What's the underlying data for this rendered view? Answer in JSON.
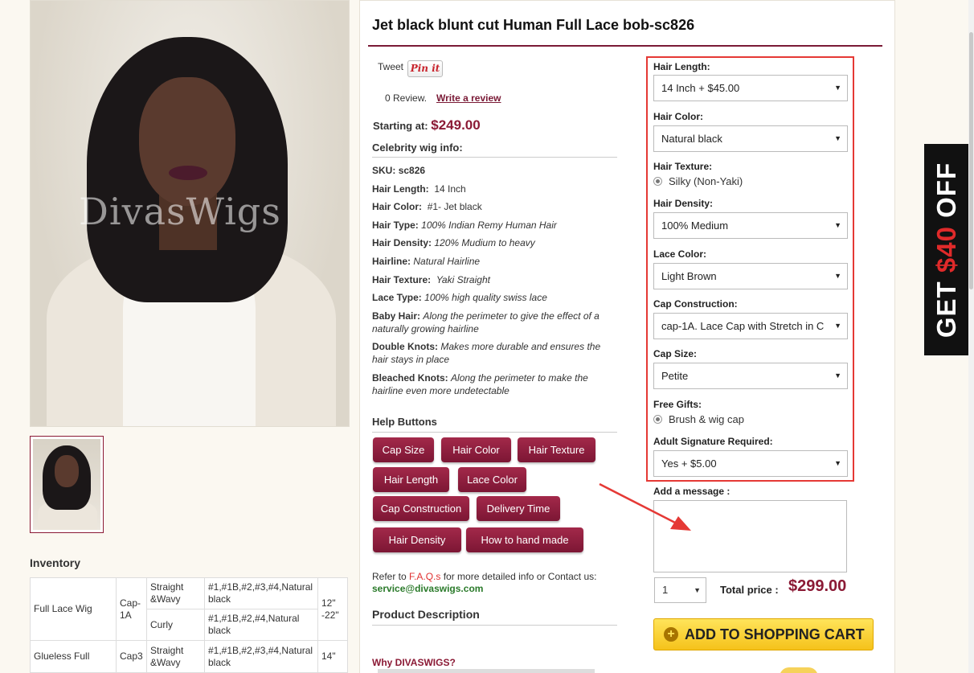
{
  "product": {
    "title": "Jet black blunt cut Human Full Lace bob-sc826",
    "watermark": "DivasWigs",
    "tweet_label": "Tweet",
    "pin_label": "Pin it",
    "review_count": "0 Review.",
    "write_review": "Write a review",
    "starting_label": "Starting at:",
    "starting_price": "$249.00"
  },
  "info": {
    "title": "Celebrity wig info:",
    "sku_k": "SKU:",
    "sku_v": "sc826",
    "length_k": "Hair Length:",
    "length_v": "14 Inch",
    "color_k": "Hair Color:",
    "color_v": "#1- Jet black",
    "type_k": "Hair Type:",
    "type_v": "100% Indian Remy Human Hair",
    "density_k": "Hair Density:",
    "density_v": "120% Mudium to heavy",
    "hairline_k": "Hairline:",
    "hairline_v": "Natural Hairline",
    "texture_k": "Hair Texture:",
    "texture_v": "Yaki Straight",
    "lace_k": "Lace Type:",
    "lace_v": "100% high quality swiss lace",
    "baby_k": "Baby Hair:",
    "baby_v": "Along the perimeter to give the effect of a naturally growing hairline",
    "knots_k": "Double Knots:",
    "knots_v": "Makes more durable and ensures the hair stays in place",
    "bleached_k": "Bleached Knots:",
    "bleached_v": "Along the perimeter to make the hairline even more undetectable"
  },
  "help": {
    "title": "Help Buttons",
    "buttons": [
      "Cap Size",
      "Hair Color",
      "Hair Texture",
      "Hair Length",
      "Lace Color",
      "Cap Construction",
      "Delivery Time",
      "Hair Density",
      "How to hand made"
    ]
  },
  "contact": {
    "refer_prefix": "Refer to",
    "faq": "F.A.Q.s",
    "refer_suffix": "for more detailed info or Contact us:",
    "email": "service@divaswigs.com"
  },
  "description": {
    "title": "Product Description",
    "why": "Why DIVASWIGS?"
  },
  "inventory": {
    "title": "Inventory",
    "rows": [
      {
        "type": "Full Lace Wig",
        "cap": "Cap-1A",
        "texture1": "Straight &Wavy",
        "colors1": "#1,#1B,#2,#3,#4,Natural black",
        "length": "12\" -22\"",
        "texture2": "Curly",
        "colors2": "#1,#1B,#2,#4,Natural black"
      },
      {
        "type": "Glueless Full",
        "cap": "Cap3",
        "texture1": "Straight &Wavy",
        "colors1": "#1,#1B,#2,#3,#4,Natural black",
        "length": "14\""
      }
    ]
  },
  "options": {
    "hair_length_label": "Hair Length:",
    "hair_length_value": "14 Inch + $45.00",
    "hair_color_label": "Hair Color:",
    "hair_color_value": "Natural black",
    "hair_texture_label": "Hair Texture:",
    "hair_texture_value": "Silky (Non-Yaki)",
    "hair_density_label": "Hair Density:",
    "hair_density_value": "100% Medium",
    "lace_color_label": "Lace Color:",
    "lace_color_value": "Light Brown",
    "cap_construction_label": "Cap Construction:",
    "cap_construction_value": "cap-1A. Lace Cap with Stretch in C",
    "cap_size_label": "Cap Size:",
    "cap_size_value": "Petite",
    "free_gifts_label": "Free Gifts:",
    "free_gifts_value": "Brush & wig cap",
    "signature_label": "Adult Signature Required:",
    "signature_value": "Yes + $5.00",
    "arrow_glyph": "▼"
  },
  "order": {
    "message_label": "Add a message :",
    "quantity": "1",
    "total_label": "Total price :",
    "total_price": "$299.00",
    "cart_label": "ADD TO SHOPPING CART",
    "plus_glyph": "+"
  },
  "promo": {
    "prefix": "GET ",
    "amount": "$40",
    "suffix": " OFF"
  },
  "colors": {
    "brand": "#8b1a35",
    "highlight_border": "#e53935",
    "cart_yellow": "#f5c21b"
  }
}
